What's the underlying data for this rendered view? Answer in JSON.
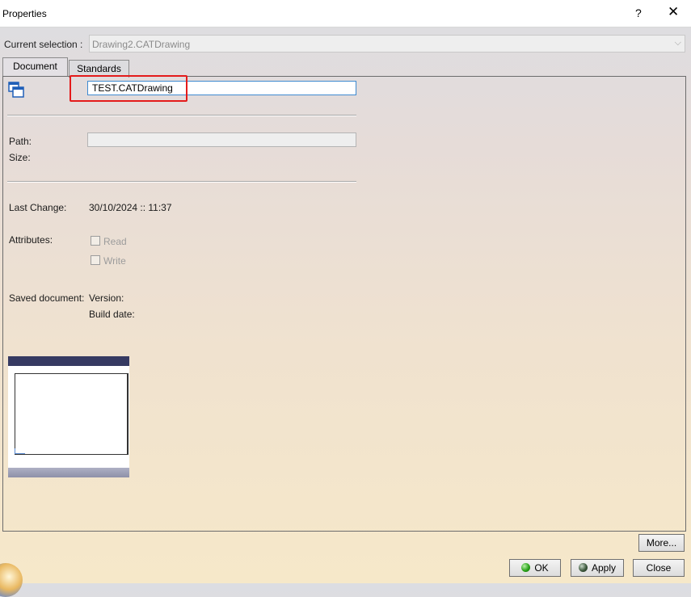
{
  "window": {
    "title": "Properties",
    "help_glyph": "?",
    "close_glyph": "✕"
  },
  "selection": {
    "label": "Current selection :",
    "value": "Drawing2.CATDrawing",
    "arrow": "⌵"
  },
  "tabs": [
    {
      "label": "Document",
      "active": true
    },
    {
      "label": "Standards",
      "active": false
    }
  ],
  "document": {
    "icon": "document-windows-icon",
    "name": "TEST.CATDrawing",
    "path_label": "Path:",
    "path_value": "",
    "size_label": "Size:",
    "last_change_label": "Last Change:",
    "last_change_value": "30/10/2024 :: 11:37",
    "attributes_label": "Attributes:",
    "attributes": [
      {
        "label": "Read",
        "checked": false
      },
      {
        "label": "Write",
        "checked": false
      }
    ],
    "saved_document_label": "Saved document:",
    "version_label": "Version:",
    "build_date_label": "Build date:"
  },
  "buttons": {
    "more": "More...",
    "ok": "OK",
    "apply": "Apply",
    "close": "Close"
  },
  "colors": {
    "highlight": "#e41b1b",
    "field_focus": "#3e8ad0"
  }
}
